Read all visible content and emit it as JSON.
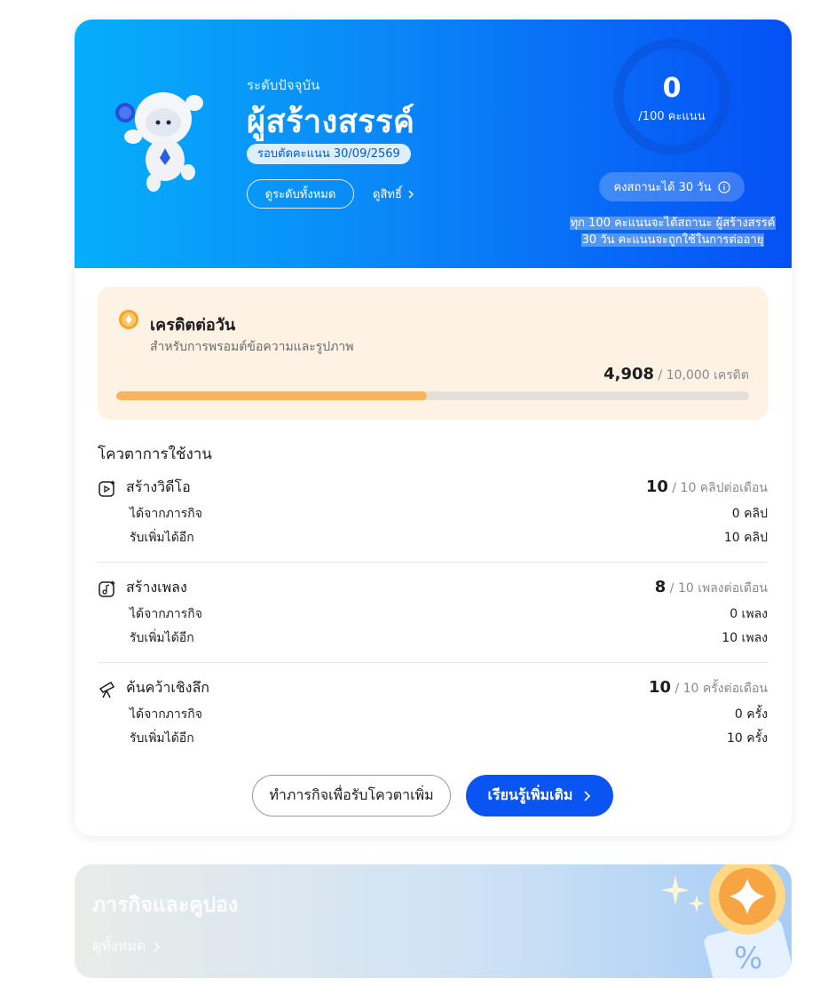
{
  "level": {
    "current_label": "ระดับปัจจุบัน",
    "name": "ผู้สร้างสรรค์",
    "cycle": "รอบตัดคะแนน 30/09/2569",
    "view_all_levels": "ดูระดับทั้งหมด",
    "view_rights": "ดูสิทธิ์",
    "score": "0",
    "score_unit": "/100 คะแนน",
    "score_progress": 0,
    "keep_status": "คงสถานะได้ 30 วัน",
    "note_line1": "ทุก 100 คะแนนจะได้สถานะ ผู้สร้างสรรค์",
    "note_line2": "30 วัน คะแนนจะถูกใช้ในการต่ออายุ"
  },
  "credit": {
    "title": "เครดิตต่อวัน",
    "subtitle": "สำหรับการพรอมต์ข้อความและรูปภาพ",
    "used": "4,908",
    "limit": "/ 10,000 เครดิต",
    "progress": 0.4908
  },
  "quota": {
    "title": "โควตาการใช้งาน",
    "row_from_missions": "ได้จากภารกิจ",
    "row_remaining": "รับเพิ่มได้อีก",
    "items": [
      {
        "icon": "video-icon",
        "name": "สร้างวิดีโอ",
        "total": "10",
        "limit": "/ 10 คลิปต่อเดือน",
        "from_missions": "0 คลิป",
        "remaining": "10 คลิป"
      },
      {
        "icon": "music-icon",
        "name": "สร้างเพลง",
        "total": "8",
        "limit": "/ 10 เพลงต่อเดือน",
        "from_missions": "0 เพลง",
        "remaining": "10 เพลง"
      },
      {
        "icon": "telescope-icon",
        "name": "ค้นคว้าเชิงลึก",
        "total": "10",
        "limit": "/ 10 ครั้งต่อเดือน",
        "from_missions": "0 ครั้ง",
        "remaining": "10 ครั้ง"
      }
    ]
  },
  "actions": {
    "missions_button": "ทำภารกิจเพื่อรับโควตาเพิ่ม",
    "learn_more_button": "เรียนรู้เพิ่มเติม"
  },
  "missions_card": {
    "title": "ภารกิจและคูปอง",
    "view_all": "ดูทั้งหมด"
  },
  "colors": {
    "hero_start": "#06aefc",
    "hero_end": "#0550f5",
    "credit_bar": "#f8b35b",
    "primary_button": "#0a55f2"
  }
}
